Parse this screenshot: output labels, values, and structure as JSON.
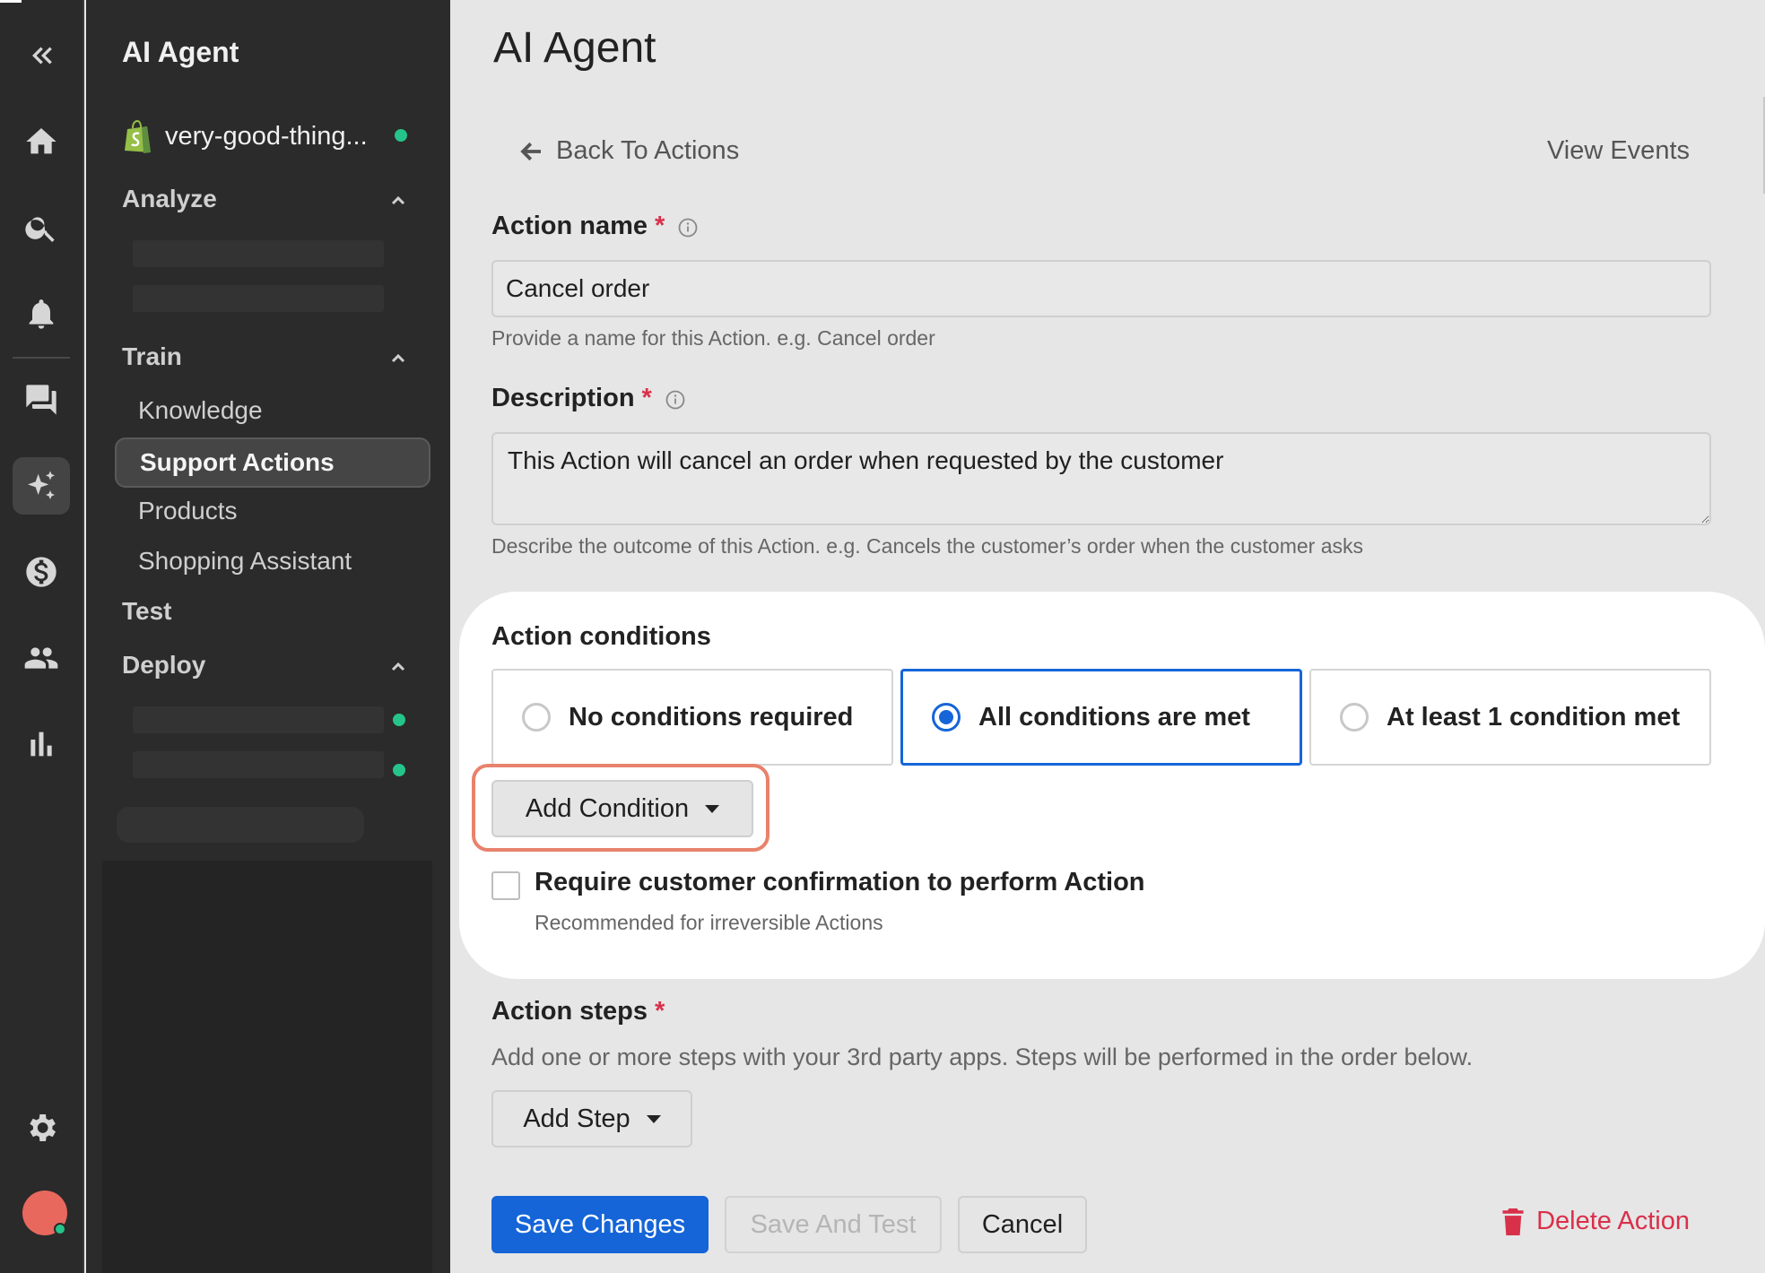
{
  "rail": {
    "icons": [
      "double-chevron-left-icon",
      "home-icon",
      "search-icon",
      "bell-icon",
      "chat-icon",
      "sparkles-icon",
      "dollar-icon",
      "users-icon",
      "bar-chart-icon",
      "gear-icon",
      "avatar"
    ]
  },
  "nav": {
    "title": "AI Agent",
    "store_name": "very-good-thing...",
    "sections": {
      "analyze": "Analyze",
      "train": "Train",
      "test": "Test",
      "deploy": "Deploy"
    },
    "train_items": [
      "Knowledge",
      "Support Actions",
      "Products",
      "Shopping Assistant"
    ],
    "active_item": "Support Actions"
  },
  "main": {
    "title": "AI Agent",
    "back_label": "Back To Actions",
    "view_events": "View Events",
    "action_name": {
      "label": "Action name",
      "required": "*",
      "value": "Cancel order",
      "hint": "Provide a name for this Action. e.g. Cancel order"
    },
    "description": {
      "label": "Description",
      "required": "*",
      "value": "This Action will cancel an order when requested by the customer",
      "hint": "Describe the outcome of this Action. e.g. Cancels the customer’s order when the customer asks"
    },
    "conditions": {
      "label": "Action conditions",
      "options": [
        "No conditions required",
        "All conditions are met",
        "At least 1 condition met"
      ],
      "selected": "All conditions are met",
      "add_condition": "Add Condition",
      "confirm_label": "Require customer confirmation to perform Action",
      "confirm_hint": "Recommended for irreversible Actions",
      "confirm_checked": false
    },
    "steps": {
      "label": "Action steps",
      "required": "*",
      "hint": "Add one or more steps with your 3rd party apps. Steps will be performed in the order below.",
      "add_step": "Add Step"
    },
    "footer": {
      "save": "Save Changes",
      "save_test": "Save And Test",
      "cancel": "Cancel",
      "delete": "Delete Action"
    }
  },
  "colors": {
    "primary": "#1565d8",
    "danger": "#d9304a",
    "status_green": "#25c48a",
    "highlight": "#e8826c"
  }
}
